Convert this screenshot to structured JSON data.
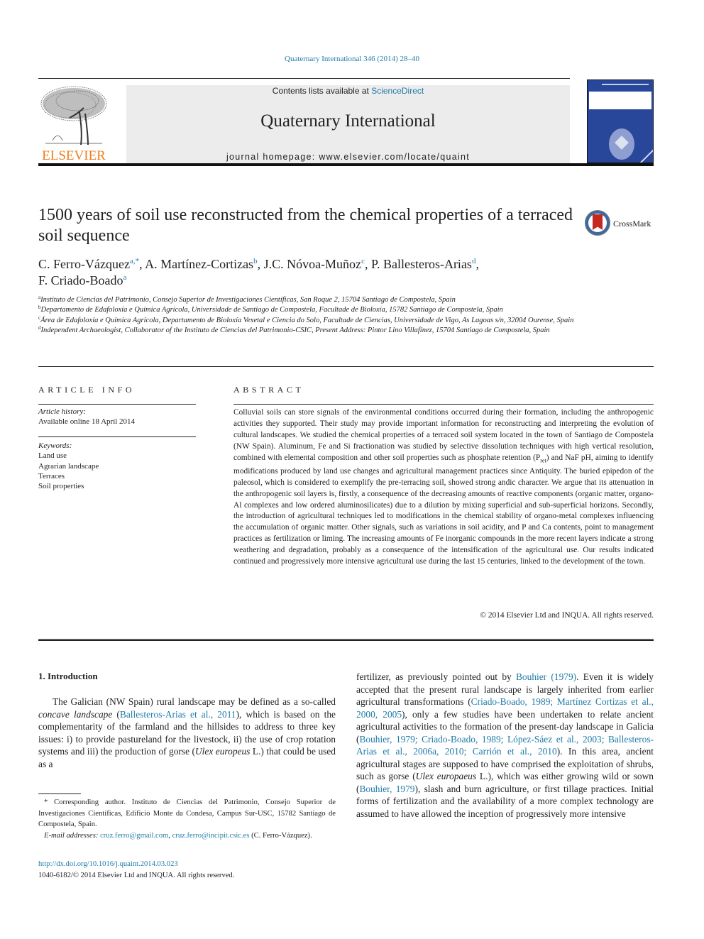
{
  "header": {
    "citation": "Quaternary International 346 (2014) 28–40",
    "contents_prefix": "Contents lists available at ",
    "contents_link": "ScienceDirect",
    "journal_name": "Quaternary International",
    "homepage": "journal homepage: www.elsevier.com/locate/quaint",
    "publisher_logo_text": "ELSEVIER",
    "colors": {
      "link": "#1f7ba8",
      "elsevier_orange": "#f07e1c",
      "cover_blue": "#28479b",
      "header_gray": "#ececec"
    }
  },
  "article": {
    "title": "1500 years of soil use reconstructed from the chemical properties of a terraced soil sequence",
    "crossmark_label": "CrossMark",
    "authors": [
      {
        "name": "C. Ferro-Vázquez",
        "sup": "a,*",
        "sep": ", "
      },
      {
        "name": "A. Martínez-Cortizas",
        "sup": "b",
        "sep": ", "
      },
      {
        "name": "J.C. Nóvoa-Muñoz",
        "sup": "c",
        "sep": ", "
      },
      {
        "name": "P. Ballesteros-Arias",
        "sup": "d",
        "sep": ","
      },
      {
        "name": "F. Criado-Boado",
        "sup": "a",
        "sep": ""
      }
    ],
    "affiliations": [
      {
        "key": "a",
        "text": "Instituto de Ciencias del Patrimonio, Consejo Superior de Investigaciones Científicas, San Roque 2, 15704 Santiago de Compostela, Spain"
      },
      {
        "key": "b",
        "text": "Departamento de Edafoloxía e Química Agrícola, Universidade de Santiago de Compostela, Facultade de Bioloxía, 15782 Santiago de Compostela, Spain"
      },
      {
        "key": "c",
        "text": "Área de Edafoloxía e Química Agrícola, Departamento de Bioloxía Vexetal e Ciencia do Solo, Facultade de Ciencias, Universidade de Vigo, As Lagoas s/n, 32004 Ourense, Spain"
      },
      {
        "key": "d",
        "text": "Independent Archaeologist, Collaborator of the Instituto de Ciencias del Patrimonio-CSIC, Present Address: Pintor Lino Villafínez, 15704 Santiago de Compostela, Spain"
      }
    ]
  },
  "article_info": {
    "heading": "ARTICLE INFO",
    "history_label": "Article history:",
    "history_value": "Available online 18 April 2014",
    "keywords_label": "Keywords:",
    "keywords": [
      "Land use",
      "Agrarian landscape",
      "Terraces",
      "Soil properties"
    ]
  },
  "abstract": {
    "heading": "ABSTRACT",
    "part1": "Colluvial soils can store signals of the environmental conditions occurred during their formation, including the anthropogenic activities they supported. Their study may provide important information for reconstructing and interpreting the evolution of cultural landscapes. We studied the chemical properties of a terraced soil system located in the town of Santiago de Compostela (NW Spain). Aluminum, Fe and Si fractionation was studied by selective dissolution techniques with high vertical resolution, combined with elemental composition and other soil properties such as phosphate retention (P",
    "sub": "ret",
    "part2": ") and NaF pH, aiming to identify modifications produced by land use changes and agricultural management practices since Antiquity. The buried epipedon of the paleosol, which is considered to exemplify the pre-terracing soil, showed strong andic character. We argue that its attenuation in the anthropogenic soil layers is, firstly, a consequence of the decreasing amounts of reactive components (organic matter, organo-Al complexes and low ordered aluminosilicates) due to a dilution by mixing superficial and sub-superficial horizons. Secondly, the introduction of agricultural techniques led to modifications in the chemical stability of organo-metal complexes influencing the accumulation of organic matter. Other signals, such as variations in soil acidity, and P and Ca contents, point to management practices as fertilization or liming. The increasing amounts of Fe inorganic compounds in the more recent layers indicate a strong weathering and degradation, probably as a consequence of the intensification of the agricultural use. Our results indicated continued and progressively more intensive agricultural use during the last 15 centuries, linked to the development of the town.",
    "copyright": "© 2014 Elsevier Ltd and INQUA. All rights reserved."
  },
  "introduction": {
    "heading": "1.  Introduction",
    "left": [
      {
        "t": "The Galician (NW Spain) rural landscape may be defined as a so-called "
      },
      {
        "t": "concave landscape",
        "style": "i"
      },
      {
        "t": " ("
      },
      {
        "t": "Ballesteros-Arias et al., 2011",
        "style": "link"
      },
      {
        "t": "), which is based on the complementarity of the farmland and the hillsides to address to three key issues: i) to provide pastureland for the livestock, ii) the use of crop rotation systems and iii) the production of gorse ("
      },
      {
        "t": "Ulex europeus",
        "style": "i"
      },
      {
        "t": " L.) that could be used as a"
      }
    ],
    "right": [
      {
        "t": "fertilizer, as previously pointed out by "
      },
      {
        "t": "Bouhier (1979)",
        "style": "link"
      },
      {
        "t": ". Even it is widely accepted that the present rural landscape is largely inherited from earlier agricultural transformations ("
      },
      {
        "t": "Criado-Boado, 1989; Martínez Cortizas et al., 2000, 2005",
        "style": "link"
      },
      {
        "t": "), only a few studies have been undertaken to relate ancient agricultural activities to the formation of the present-day landscape in Galicia ("
      },
      {
        "t": "Bouhier, 1979; Criado-Boado, 1989; López-Sáez et al., 2003; Ballesteros-Arias et al., 2006a, 2010; Carrión et al., 2010",
        "style": "link"
      },
      {
        "t": "). In this area, ancient agricultural stages are supposed to have comprised the exploitation of shrubs, such as gorse ("
      },
      {
        "t": "Ulex europaeus",
        "style": "i"
      },
      {
        "t": " L.), which was either growing wild or sown ("
      },
      {
        "t": "Bouhier, 1979",
        "style": "link"
      },
      {
        "t": "), slash and burn agriculture, or first tillage practices. Initial forms of fertilization and the availability of a more complex technology are assumed to have allowed the inception of progressively more intensive"
      }
    ]
  },
  "footnote": {
    "corresponding": "* Corresponding author. Instituto de Ciencias del Patrimonio, Consejo Superior de Investigaciones Científicas, Edificio Monte da Condesa, Campus Sur-USC, 15782 Santiago de Compostela, Spain.",
    "email_label": "E-mail addresses:",
    "email1": "cruz.ferro@gmail.com",
    "email_sep": ", ",
    "email2": "cruz.ferro@incipit.csic.es",
    "email_suffix": " (C. Ferro-Vázquez).",
    "doi": "http://dx.doi.org/10.1016/j.quaint.2014.03.023",
    "issn": "1040-6182/© 2014 Elsevier Ltd and INQUA. All rights reserved."
  }
}
